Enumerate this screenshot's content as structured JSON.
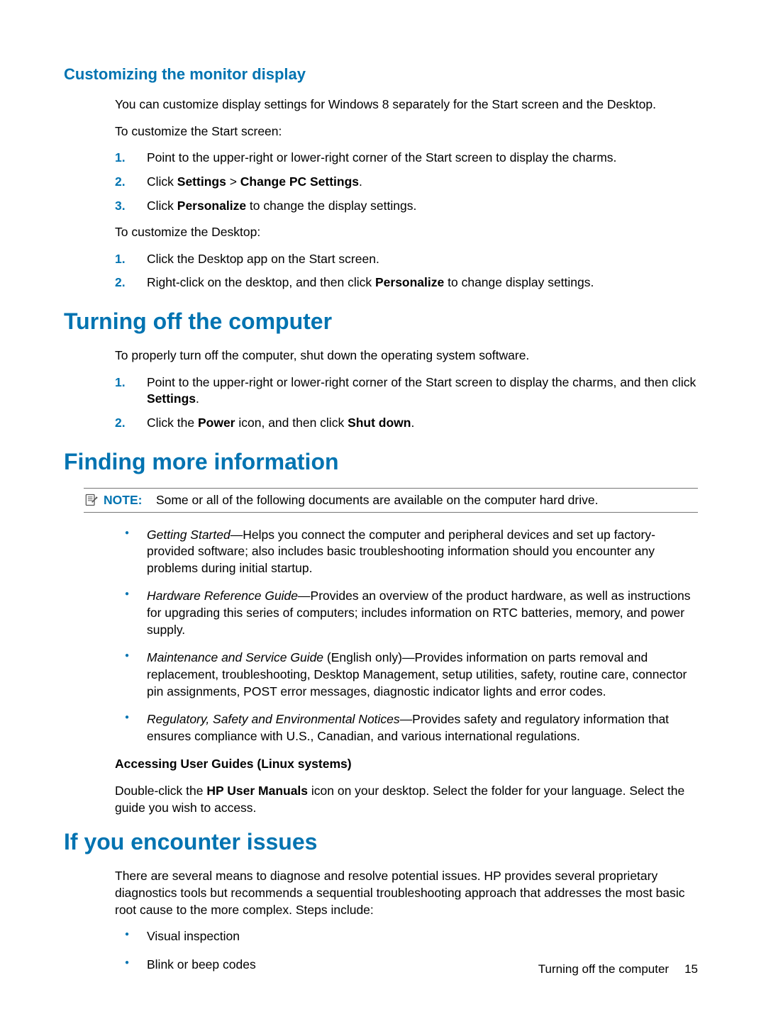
{
  "section1": {
    "heading": "Customizing the monitor display",
    "p1": "You can customize display settings for Windows 8 separately for the Start screen and the Desktop.",
    "p2": "To customize the Start screen:",
    "steps1": [
      {
        "num": "1.",
        "text": "Point to the upper-right or lower-right corner of the Start screen to display the charms."
      },
      {
        "num": "2.",
        "pre": "Click ",
        "b1": "Settings",
        "mid": " > ",
        "b2": "Change PC Settings",
        "post": "."
      },
      {
        "num": "3.",
        "pre": "Click ",
        "b1": "Personalize",
        "post": " to change the display settings."
      }
    ],
    "p3": "To customize the Desktop:",
    "steps2": [
      {
        "num": "1.",
        "text": "Click the Desktop app on the Start screen."
      },
      {
        "num": "2.",
        "pre": "Right-click on the desktop, and then click ",
        "b1": "Personalize",
        "post": " to change display settings."
      }
    ]
  },
  "section2": {
    "heading": "Turning off the computer",
    "p1": "To properly turn off the computer, shut down the operating system software.",
    "steps": [
      {
        "num": "1.",
        "pre": "Point to the upper-right or lower-right corner of the Start screen to display the charms, and then click ",
        "b1": "Settings",
        "post": "."
      },
      {
        "num": "2.",
        "pre": "Click the ",
        "b1": "Power",
        "mid": " icon, and then click ",
        "b2": "Shut down",
        "post": "."
      }
    ]
  },
  "section3": {
    "heading": "Finding more information",
    "note_label": "NOTE:",
    "note_text": "Some or all of the following documents are available on the computer hard drive.",
    "bullets": [
      {
        "title": "Getting Started",
        "text": "—Helps you connect the computer and peripheral devices and set up factory-provided software; also includes basic troubleshooting information should you encounter any problems during initial startup."
      },
      {
        "title": "Hardware Reference Guide",
        "text": "—Provides an overview of the product hardware, as well as instructions for upgrading this series of computers; includes information on RTC batteries, memory, and power supply."
      },
      {
        "title": "Maintenance and Service Guide",
        "after_title": " (English only)",
        "text": "—Provides information on parts removal and replacement, troubleshooting, Desktop Management, setup utilities, safety, routine care, connector pin assignments, POST error messages, diagnostic indicator lights and error codes."
      },
      {
        "title": "Regulatory, Safety and Environmental Notices",
        "text": "—Provides safety and regulatory information that ensures compliance with U.S., Canadian, and various international regulations."
      }
    ],
    "subheading": "Accessing User Guides (Linux systems)",
    "p2_pre": "Double-click the ",
    "p2_bold": "HP User Manuals",
    "p2_post": " icon on your desktop. Select the folder for your language. Select the guide you wish to access."
  },
  "section4": {
    "heading": "If you encounter issues",
    "p1": "There are several means to diagnose and resolve potential issues. HP provides several proprietary diagnostics tools but recommends a sequential troubleshooting approach that addresses the most basic root cause to the more complex. Steps include:",
    "bullets": [
      "Visual inspection",
      "Blink or beep codes"
    ]
  },
  "footer": {
    "text": "Turning off the computer",
    "page": "15"
  }
}
